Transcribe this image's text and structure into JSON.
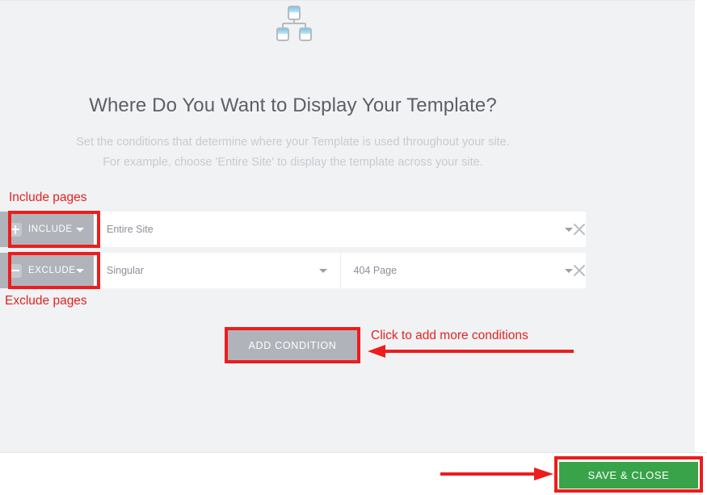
{
  "panel": {
    "icon_name": "sitemap-icon",
    "heading": "Where Do You Want to Display Your Template?",
    "subtitle_line1": "Set the conditions that determine where your Template is used throughout your site.",
    "subtitle_line2": "For example, choose 'Entire Site' to display the template across your site."
  },
  "conditions": [
    {
      "type_label": "INCLUDE",
      "type_icon": "plus-square-icon",
      "selects": [
        {
          "value": "Entire Site",
          "width": "full"
        }
      ],
      "remove_icon": "close-icon"
    },
    {
      "type_label": "EXCLUDE",
      "type_icon": "minus-square-icon",
      "selects": [
        {
          "value": "Singular",
          "width": "half"
        },
        {
          "value": "404 Page",
          "width": "half"
        }
      ],
      "remove_icon": "close-icon"
    }
  ],
  "buttons": {
    "add_condition": "ADD CONDITION",
    "save_and_close": "SAVE & CLOSE"
  },
  "annotations": {
    "include_pages": "Include pages",
    "exclude_pages": "Exclude pages",
    "add_more": "Click to add more conditions"
  },
  "scrollbar": {
    "up_icon": "chevron-up-icon",
    "down_icon": "chevron-down-icon",
    "thumb_name": "scrollbar-thumb"
  },
  "colors": {
    "panel_bg": "#f1f2f4",
    "button_gray": "#b0b4ba",
    "save_green": "#39a349",
    "annotation_red": "#ee1c1c",
    "heading_gray": "#5b5f66",
    "subtitle_gray": "#c7cbd1"
  }
}
